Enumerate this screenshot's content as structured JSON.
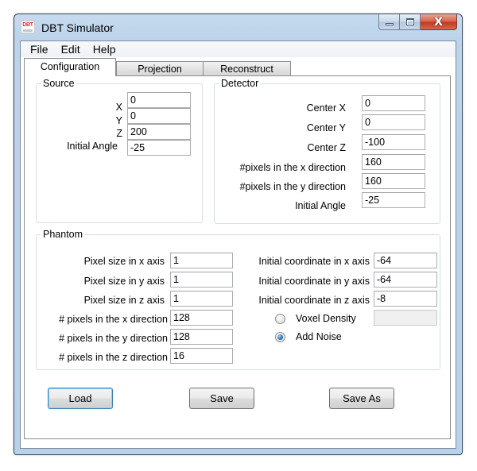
{
  "window": {
    "title": "DBT Simulator",
    "app_icon": "dbt-app-icon",
    "caption_buttons": {
      "minimize": "minimize-icon",
      "maximize": "maximize-icon",
      "close": "close-icon",
      "close_glyph": "X"
    }
  },
  "menu": [
    {
      "label": "File"
    },
    {
      "label": "Edit"
    },
    {
      "label": "Help"
    }
  ],
  "tabs": [
    {
      "label": "Configuration",
      "active": true
    },
    {
      "label": "Projection",
      "active": false
    },
    {
      "label": "Reconstruct",
      "active": false
    }
  ],
  "source": {
    "title": "Source",
    "fields": [
      {
        "label": "X",
        "value": "0"
      },
      {
        "label": "Y",
        "value": "0"
      },
      {
        "label": "Z",
        "value": "200"
      },
      {
        "label": "Initial Angle",
        "value": "-25"
      }
    ]
  },
  "detector": {
    "title": "Detector",
    "fields": [
      {
        "label": "Center X",
        "value": "0"
      },
      {
        "label": "Center Y",
        "value": "0"
      },
      {
        "label": "Center Z",
        "value": "-100"
      },
      {
        "label": "#pixels in the x direction",
        "value": "160"
      },
      {
        "label": "#pixels in the y direction",
        "value": "160"
      },
      {
        "label": "Initial Angle",
        "value": "-25"
      }
    ]
  },
  "phantom": {
    "title": "Phantom",
    "left_fields": [
      {
        "label": "Pixel size in x axis",
        "value": "1"
      },
      {
        "label": "Pixel size in y axis",
        "value": "1"
      },
      {
        "label": "Pixel size in z axis",
        "value": "1"
      },
      {
        "label": "# pixels in the x direction",
        "value": "128"
      },
      {
        "label": "# pixels in the y direction",
        "value": "128"
      },
      {
        "label": "# pixels in the z direction",
        "value": "16"
      }
    ],
    "right_fields": [
      {
        "label": "Initial coordinate in x axis",
        "value": "-64"
      },
      {
        "label": "Initial coordinate in y axis",
        "value": "-64"
      },
      {
        "label": "Initial coordinate in z axis",
        "value": "-8"
      }
    ],
    "options": [
      {
        "label": "Voxel Density",
        "checked": false,
        "value": ""
      },
      {
        "label": "Add Noise",
        "checked": true
      }
    ]
  },
  "buttons": {
    "load": "Load",
    "save": "Save",
    "save_as": "Save As"
  }
}
